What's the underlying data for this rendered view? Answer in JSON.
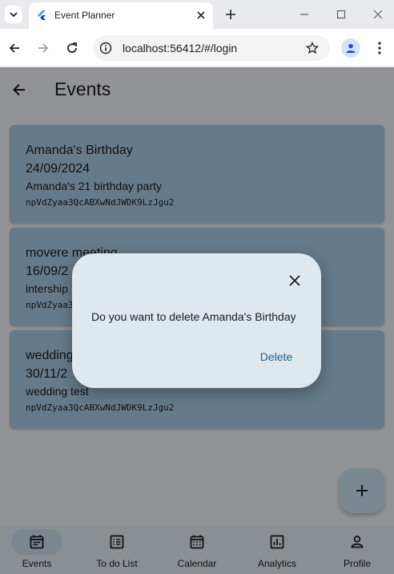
{
  "browser": {
    "tab_title": "Event Planner",
    "url": "localhost:56412/#/login"
  },
  "app": {
    "title": "Events",
    "events": [
      {
        "name": "Amanda's Birthday",
        "date": "24/09/2024",
        "description": "Amanda's 21 birthday party",
        "uid": "npVdZyaa3QcABXwNdJWDK9LzJgu2"
      },
      {
        "name": "movere meeting",
        "date": "16/09/2",
        "description": "intership",
        "uid": "npVdZyaa3"
      },
      {
        "name": "wedding",
        "date": "30/11/2",
        "description": "wedding test",
        "uid": "npVdZyaa3QcABXwNdJWDK9LzJgu2"
      }
    ],
    "nav": [
      {
        "label": "Events",
        "icon": "event-note-icon",
        "active": true
      },
      {
        "label": "To do List",
        "icon": "list-icon",
        "active": false
      },
      {
        "label": "Calendar",
        "icon": "calendar-icon",
        "active": false
      },
      {
        "label": "Analytics",
        "icon": "analytics-icon",
        "active": false
      },
      {
        "label": "Profile",
        "icon": "person-icon",
        "active": false
      }
    ]
  },
  "dialog": {
    "message": "Do you want to delete Amanda's Birthday",
    "delete_label": "Delete"
  },
  "colors": {
    "card": "#a8cbe6",
    "dialog": "#dfe8ef",
    "accent": "#1e5f86"
  }
}
